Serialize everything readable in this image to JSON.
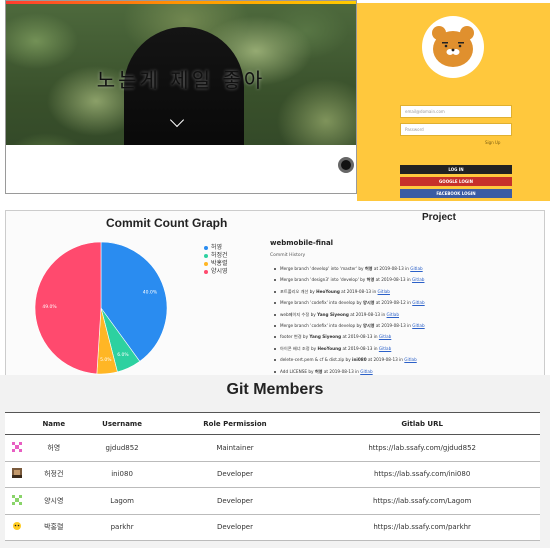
{
  "hero": {
    "title": "노는게 제일 좋아",
    "caption": " "
  },
  "login": {
    "email_placeholder": "email@domain.com",
    "password_placeholder": "Password",
    "signup_link": "Sign Up",
    "login_button": "LOG IN",
    "google_button": "GOOGLE LOGIN",
    "facebook_button": "FACEBOOK LOGIN"
  },
  "commit_graph": {
    "title": "Commit Count Graph"
  },
  "chart_data": {
    "type": "pie",
    "title": "Commit Count Graph",
    "categories": [
      "허영",
      "허정건",
      "박홍렬",
      "양시영"
    ],
    "values": [
      40.0,
      6.0,
      5.0,
      49.0
    ],
    "labels": [
      "40.0%",
      "6.0%",
      "5.0%",
      "49.0%"
    ],
    "colors": [
      "#2a8cf0",
      "#2dd1a0",
      "#ffb625",
      "#ff4a6e"
    ],
    "legend": "right"
  },
  "project": {
    "heading": "Project",
    "name": "webmobile-final",
    "history_label": "Commit History",
    "commits": [
      {
        "message": "Merge branch 'develop' into 'master' by ",
        "author": "허영",
        "date": " at 2019-08-13 in ",
        "link": "Gitlab"
      },
      {
        "message": "Merge branch 'design3' into 'develop' by ",
        "author": "허영",
        "date": " at 2019-08-13 in ",
        "link": "Gitlab"
      },
      {
        "message": "포트폴리오 개선 by ",
        "author": "HeoYoung",
        "date": " at 2019-08-13 in ",
        "link": "Gitlab"
      },
      {
        "message": "Merge branch 'codefix' into develop by ",
        "author": "양시영",
        "date": " at 2019-08-12 in ",
        "link": "Gitlab"
      },
      {
        "message": "web페이지 수정 by ",
        "author": "Yang Siyeong",
        "date": " at 2019-08-13 in ",
        "link": "Gitlab"
      },
      {
        "message": "Merge branch 'codefix' into develop by ",
        "author": "양시영",
        "date": " at 2019-08-13 in ",
        "link": "Gitlab"
      },
      {
        "message": "footer 변경 by ",
        "author": "Yang Siyeong",
        "date": " at 2019-08-13 in ",
        "link": "Gitlab"
      },
      {
        "message": "아이콘 배너 조정 by ",
        "author": "HeoYoung",
        "date": " at 2019-08-13 in ",
        "link": "Gitlab"
      },
      {
        "message": "delete-cert.pem & cf & dist.zip by ",
        "author": "ini080",
        "date": " at 2019-08-13 in ",
        "link": "Gitlab"
      },
      {
        "message": "Add LICENSE by ",
        "author": "허영",
        "date": " at 2019-08-13 in ",
        "link": "Gitlab"
      }
    ]
  },
  "members": {
    "title": "Git Members",
    "headers": [
      "Name",
      "Username",
      "Role Permission",
      "Gitlab URL"
    ],
    "rows": [
      {
        "avatar": "pixel-avatar-pink",
        "name": "허영",
        "username": "gjdud852",
        "role": "Maintainer",
        "url": "https://lab.ssafy.com/gjdud852"
      },
      {
        "avatar": "photo-avatar-brown",
        "name": "허정건",
        "username": "ini080",
        "role": "Developer",
        "url": "https://lab.ssafy.com/ini080"
      },
      {
        "avatar": "pixel-avatar-green",
        "name": "양시영",
        "username": "Lagom",
        "role": "Developer",
        "url": "https://lab.ssafy.com/Lagom"
      },
      {
        "avatar": "emoji-avatar-yellow",
        "name": "박홍렬",
        "username": "parkhr",
        "role": "Developer",
        "url": "https://lab.ssafy.com/parkhr"
      }
    ]
  }
}
